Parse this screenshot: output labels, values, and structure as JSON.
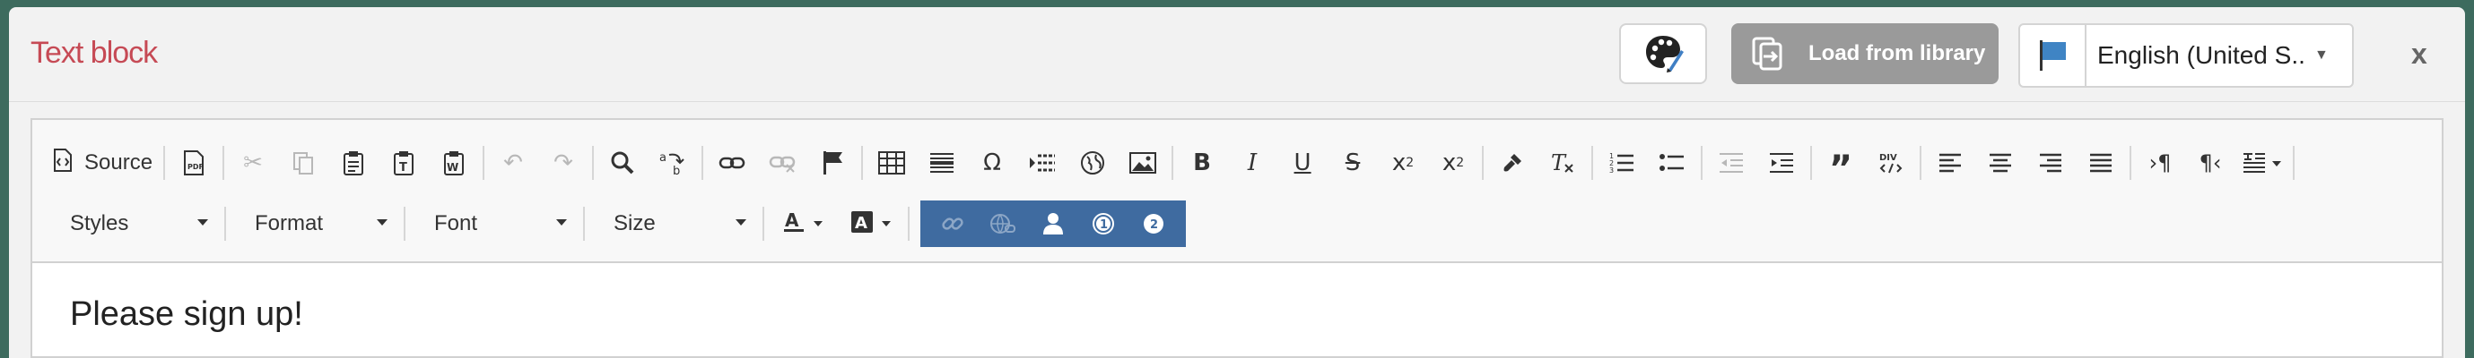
{
  "header": {
    "title": "Text block",
    "load_button_label": "Load from library",
    "language": "English (United S...",
    "close_label": "x"
  },
  "toolbar": {
    "source_label": "Source",
    "styles_label": "Styles",
    "format_label": "Format",
    "font_label": "Font",
    "size_label": "Size"
  },
  "editor": {
    "content": "Please sign up!"
  },
  "colors": {
    "title": "#c64a55",
    "load_button_bg": "#9a9a9a",
    "plugin_group_bg": "#3f6ba0"
  }
}
